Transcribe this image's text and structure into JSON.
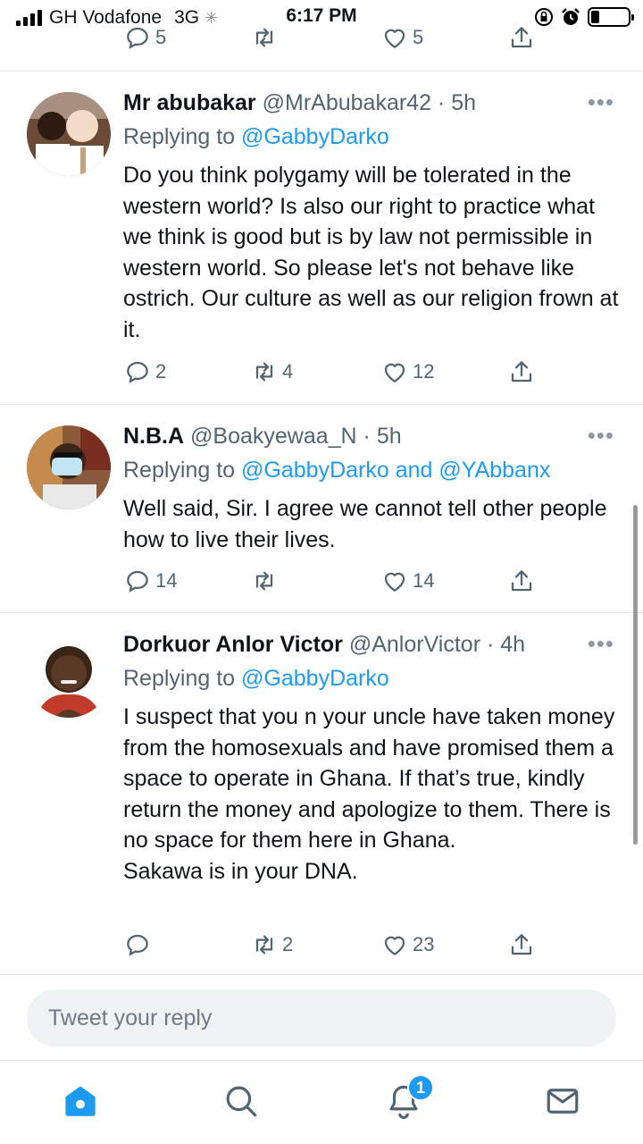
{
  "status_bar": {
    "carrier": "GH Vodafone",
    "network": "3G",
    "time": "6:17 PM"
  },
  "top_partial": {
    "replies": "5",
    "retweets": "",
    "likes": "5"
  },
  "tweets": [
    {
      "name": "Mr abubakar",
      "handle": "@MrAbubakar42",
      "time": "5h",
      "replying_prefix": "Replying to ",
      "replying_to": "@GabbyDarko",
      "replying_and": "",
      "replying_to_2": "",
      "body": "Do you think polygamy will be tolerated in the western world? Is also our right to practice what we think is good but is by law not permissible in western world. So please let's not behave like ostrich. Our culture as well as our religion frown at it.",
      "replies": "2",
      "retweets": "4",
      "likes": "12"
    },
    {
      "name": "N.B.A",
      "handle": "@Boakyewaa_N",
      "time": "5h",
      "replying_prefix": "Replying to ",
      "replying_to": "@GabbyDarko",
      "replying_and": " and ",
      "replying_to_2": "@YAbbanx",
      "body": "Well said, Sir. I agree we cannot tell other people how to live their lives.",
      "replies": "14",
      "retweets": "",
      "likes": "14"
    },
    {
      "name": "Dorkuor Anlor Victor",
      "handle": "@AnlorVictor",
      "time": "4h",
      "replying_prefix": "Replying to ",
      "replying_to": "@GabbyDarko",
      "replying_and": "",
      "replying_to_2": "",
      "body": "I suspect that you n your uncle have taken money from the homosexuals and have promised them a space to operate in Ghana. If that’s true, kindly return the money and apologize to them. There is no space for them here in Ghana.\nSakawa is in your DNA.",
      "replies": "",
      "retweets": "2",
      "likes": "23"
    }
  ],
  "reply_box": {
    "placeholder": "Tweet your reply"
  },
  "bottom_nav": {
    "notification_count": "1"
  },
  "colors": {
    "accent": "#1d9bf0",
    "muted": "#536471",
    "divider": "#e1e6ea"
  }
}
